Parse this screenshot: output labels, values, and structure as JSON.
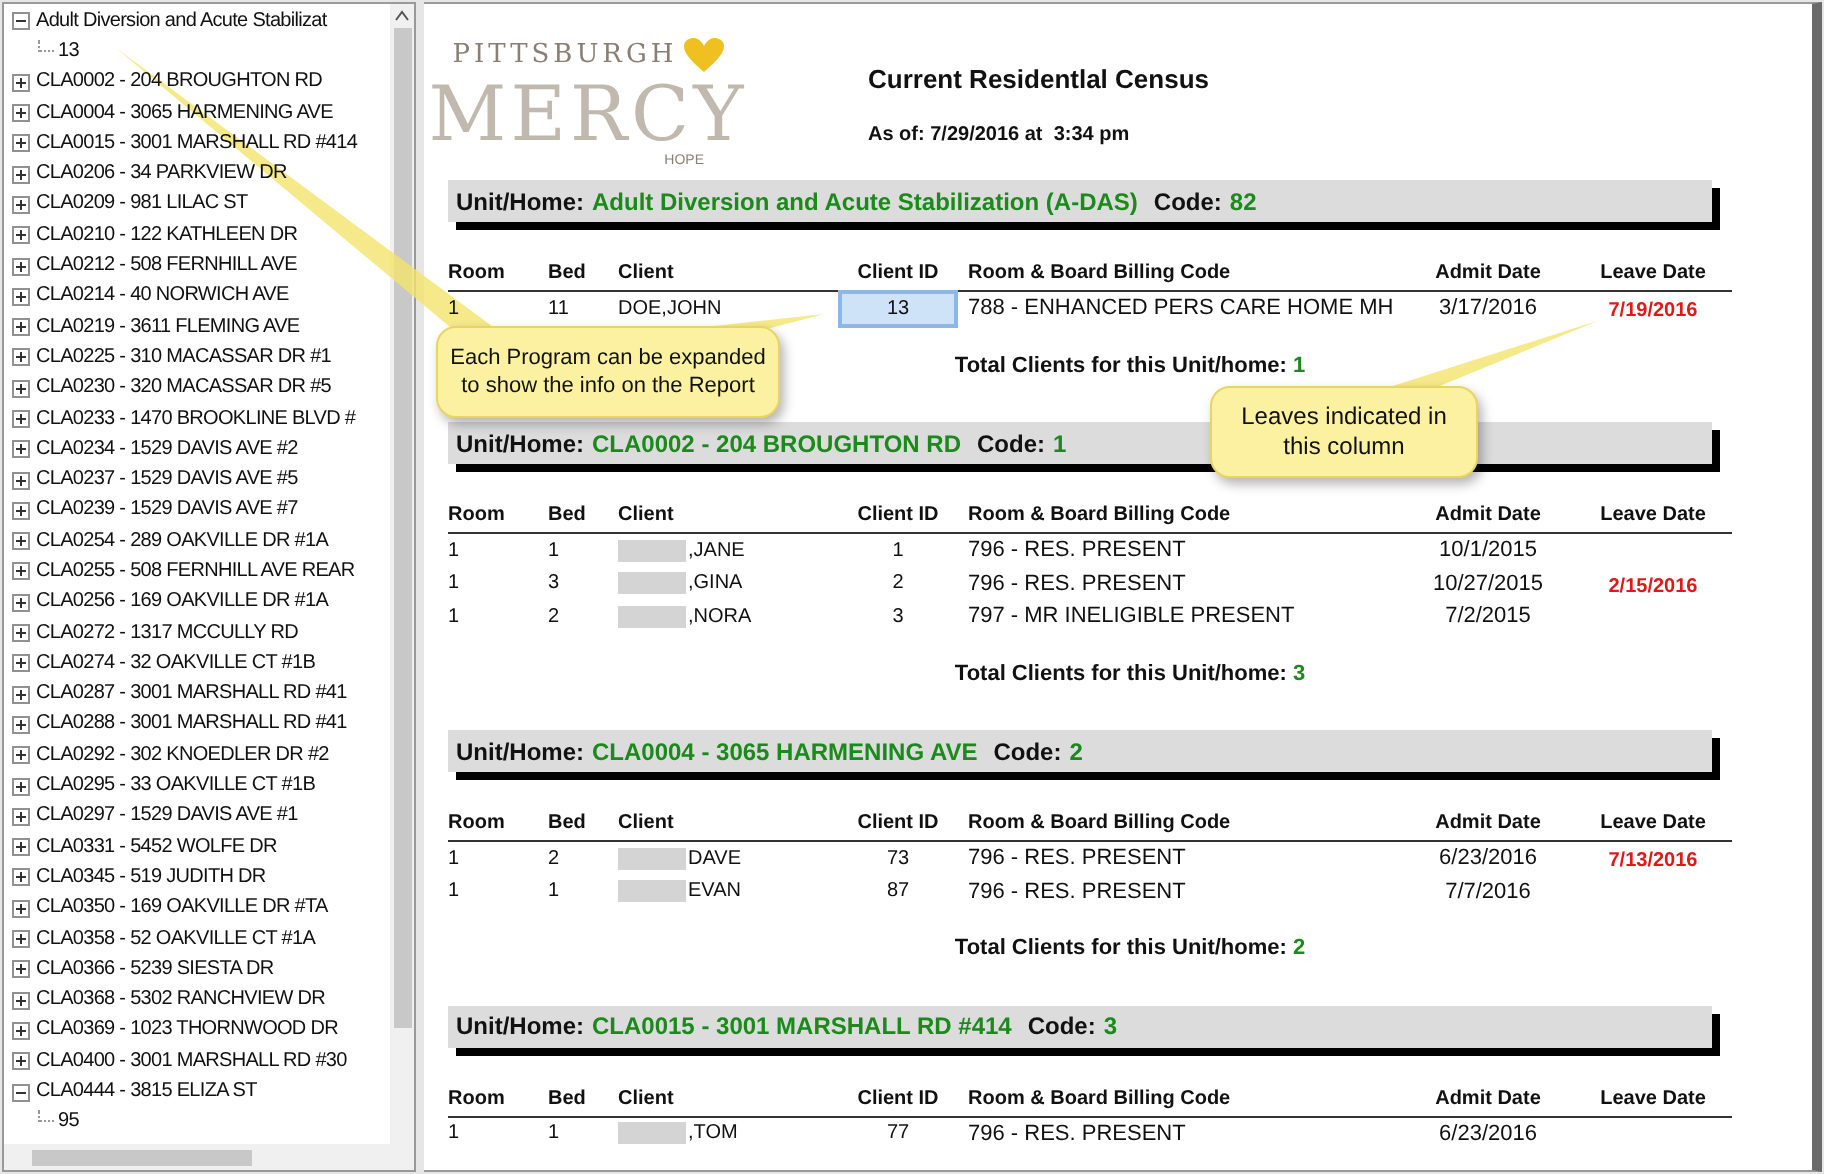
{
  "tree": {
    "items": [
      {
        "label": "Adult Diversion and Acute Stabilizat",
        "expanded": true,
        "children": [
          {
            "label": "13"
          }
        ]
      },
      {
        "label": "CLA0002 - 204 BROUGHTON RD",
        "expanded": false
      },
      {
        "label": "CLA0004 - 3065 HARMENING AVE",
        "expanded": false
      },
      {
        "label": "CLA0015 - 3001 MARSHALL RD #414",
        "expanded": false
      },
      {
        "label": "CLA0206 - 34 PARKVIEW DR",
        "expanded": false
      },
      {
        "label": "CLA0209 - 981 LILAC ST",
        "expanded": false
      },
      {
        "label": "CLA0210 - 122 KATHLEEN DR",
        "expanded": false
      },
      {
        "label": "CLA0212 - 508 FERNHILL AVE",
        "expanded": false
      },
      {
        "label": "CLA0214 - 40 NORWICH AVE",
        "expanded": false
      },
      {
        "label": "CLA0219 - 3611 FLEMING AVE",
        "expanded": false
      },
      {
        "label": "CLA0225 - 310 MACASSAR DR #1",
        "expanded": false
      },
      {
        "label": "CLA0230 - 320 MACASSAR DR #5",
        "expanded": false
      },
      {
        "label": "CLA0233 - 1470 BROOKLINE BLVD #",
        "expanded": false
      },
      {
        "label": "CLA0234 - 1529 DAVIS AVE #2",
        "expanded": false
      },
      {
        "label": "CLA0237 - 1529 DAVIS AVE #5",
        "expanded": false
      },
      {
        "label": "CLA0239 - 1529 DAVIS AVE #7",
        "expanded": false
      },
      {
        "label": "CLA0254 - 289 OAKVILLE DR #1A",
        "expanded": false
      },
      {
        "label": "CLA0255 - 508 FERNHILL AVE REAR",
        "expanded": false
      },
      {
        "label": "CLA0256 - 169 OAKVILLE DR #1A",
        "expanded": false
      },
      {
        "label": "CLA0272 - 1317 MCCULLY RD",
        "expanded": false
      },
      {
        "label": "CLA0274 - 32 OAKVILLE CT #1B",
        "expanded": false
      },
      {
        "label": "CLA0287 - 3001 MARSHALL RD #41",
        "expanded": false
      },
      {
        "label": "CLA0288 - 3001 MARSHALL RD #41",
        "expanded": false
      },
      {
        "label": "CLA0292 - 302 KNOEDLER DR #2",
        "expanded": false
      },
      {
        "label": "CLA0295 - 33 OAKVILLE CT #1B",
        "expanded": false
      },
      {
        "label": "CLA0297 - 1529 DAVIS AVE #1",
        "expanded": false
      },
      {
        "label": "CLA0331 - 5452 WOLFE DR",
        "expanded": false
      },
      {
        "label": "CLA0345 - 519 JUDITH DR",
        "expanded": false
      },
      {
        "label": "CLA0350 - 169 OAKVILLE DR #TA",
        "expanded": false
      },
      {
        "label": "CLA0358 - 52 OAKVILLE CT #1A",
        "expanded": false
      },
      {
        "label": "CLA0366 - 5239 SIESTA DR",
        "expanded": false
      },
      {
        "label": "CLA0368 - 5302 RANCHVIEW DR",
        "expanded": false
      },
      {
        "label": "CLA0369 - 1023 THORNWOOD DR",
        "expanded": false
      },
      {
        "label": "CLA0400 - 3001 MARSHALL RD #30",
        "expanded": false
      },
      {
        "label": "CLA0444 - 3815 ELIZA ST",
        "expanded": true,
        "children": [
          {
            "label": "95"
          }
        ]
      }
    ]
  },
  "report": {
    "logo": {
      "top": "PITTSBURGH",
      "main": "MERCY",
      "bottom": "HOPE"
    },
    "title": "Current Residentlal Census",
    "as_of": "As of: 7/29/2016 at  3:34 pm",
    "sections": [
      {
        "unit_label": "Unit/Home:",
        "unit": "Adult Diversion and Acute Stabilization (A-DAS)",
        "code_label": "Code:",
        "code": "82",
        "columns": [
          "Room",
          "Bed",
          "Client",
          "Client ID",
          "Room & Board Billing Code",
          "Admit Date",
          "Leave Date"
        ],
        "rows": [
          {
            "room": "1",
            "bed": "11",
            "client": "DOE,JOHN",
            "redacted": false,
            "client_id": "13",
            "selected": true,
            "billing": "788 - ENHANCED PERS CARE HOME MH",
            "admit": "3/17/2016",
            "leave": "7/19/2016"
          }
        ],
        "total_label": "Total Clients for this Unit/home:",
        "total": "1"
      },
      {
        "unit_label": "Unit/Home:",
        "unit": "CLA0002 - 204 BROUGHTON RD",
        "code_label": "Code:",
        "code": "1",
        "columns": [
          "Room",
          "Bed",
          "Client",
          "Client ID",
          "Room & Board Billing Code",
          "Admit Date",
          "Leave Date"
        ],
        "rows": [
          {
            "room": "1",
            "bed": "1",
            "client": ",JANE",
            "redacted": true,
            "client_id": "1",
            "selected": false,
            "billing": "796 - RES. PRESENT",
            "admit": "10/1/2015",
            "leave": ""
          },
          {
            "room": "1",
            "bed": "3",
            "client": ",GINA",
            "redacted": true,
            "client_id": "2",
            "selected": false,
            "billing": "796 - RES. PRESENT",
            "admit": "10/27/2015",
            "leave": "2/15/2016"
          },
          {
            "room": "1",
            "bed": "2",
            "client": ",NORA",
            "redacted": true,
            "client_id": "3",
            "selected": false,
            "billing": "797 - MR INELIGIBLE PRESENT",
            "admit": "7/2/2015",
            "leave": ""
          }
        ],
        "total_label": "Total Clients for this Unit/home:",
        "total": "3"
      },
      {
        "unit_label": "Unit/Home:",
        "unit": "CLA0004 - 3065 HARMENING AVE",
        "code_label": "Code:",
        "code": "2",
        "columns": [
          "Room",
          "Bed",
          "Client",
          "Client ID",
          "Room & Board Billing Code",
          "Admit Date",
          "Leave Date"
        ],
        "rows": [
          {
            "room": "1",
            "bed": "2",
            "client": "DAVE",
            "redacted": true,
            "client_id": "73",
            "selected": false,
            "billing": "796 - RES. PRESENT",
            "admit": "6/23/2016",
            "leave": "7/13/2016"
          },
          {
            "room": "1",
            "bed": "1",
            "client": "EVAN",
            "redacted": true,
            "client_id": "87",
            "selected": false,
            "billing": "796 - RES. PRESENT",
            "admit": "7/7/2016",
            "leave": ""
          }
        ],
        "total_label": "Total Clients for this Unit/home:",
        "total": "2"
      },
      {
        "unit_label": "Unit/Home:",
        "unit": "CLA0015 - 3001 MARSHALL RD #414",
        "code_label": "Code:",
        "code": "3",
        "columns": [
          "Room",
          "Bed",
          "Client",
          "Client ID",
          "Room & Board Billing Code",
          "Admit Date",
          "Leave Date"
        ],
        "rows": [
          {
            "room": "1",
            "bed": "1",
            "client": ",TOM",
            "redacted": true,
            "client_id": "77",
            "selected": false,
            "billing": "796 - RES. PRESENT",
            "admit": "6/23/2016",
            "leave": ""
          }
        ]
      }
    ]
  },
  "callouts": [
    {
      "text": "Each Program can be expanded to show the info on the Report"
    },
    {
      "text": "Leaves indicated in this column"
    }
  ]
}
